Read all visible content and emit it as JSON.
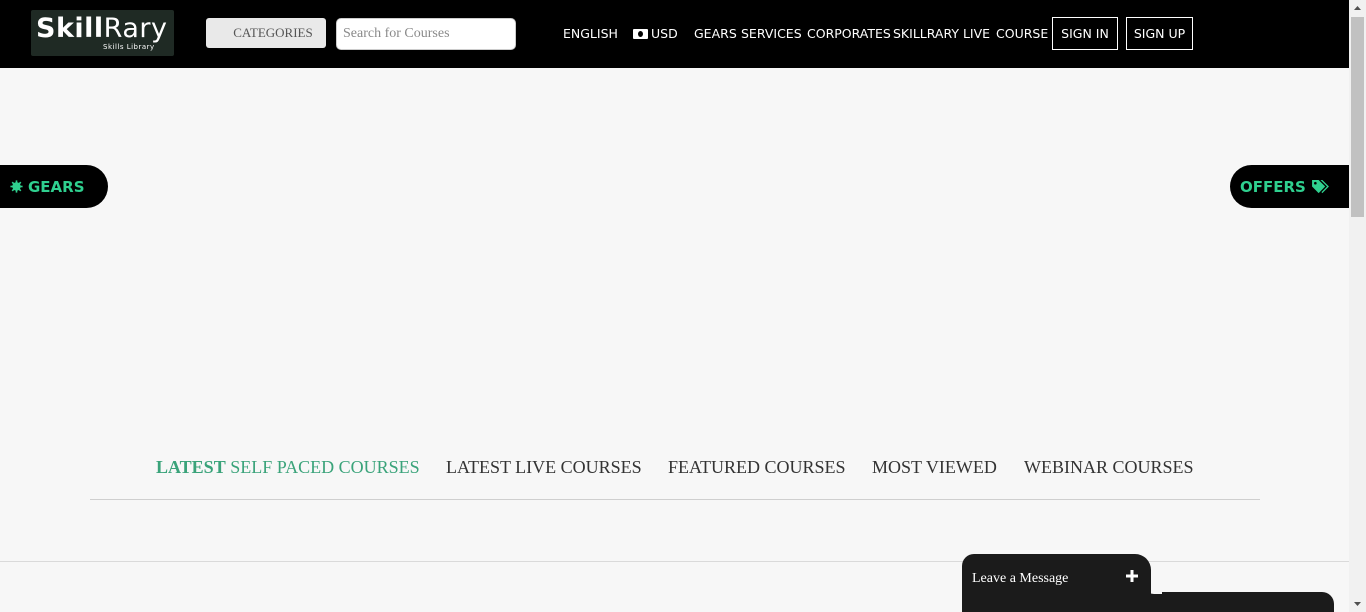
{
  "header": {
    "logo_main_a": "Skill",
    "logo_main_b": "Rary",
    "logo_sub": "Skills Library",
    "categories_label": "CATEGORIES",
    "search_placeholder": "Search for Courses",
    "nav": {
      "language": "ENGLISH",
      "currency": "USD",
      "gears": "GEARS",
      "services": "SERVICES",
      "corporates": "CORPORATES",
      "skillrary_live": "SKILLRARY LIVE",
      "course": "COURSE"
    },
    "sign_in": "SIGN IN",
    "sign_up": "SIGN UP"
  },
  "side_tabs": {
    "gears": "GEARS",
    "offers": "OFFERS"
  },
  "course_tabs": {
    "latest_self_paced_a": "LATEST",
    "latest_self_paced_b": " SELF PACED COURSES",
    "latest_live": "LATEST LIVE COURSES",
    "featured": "FEATURED COURSES",
    "most_viewed": "MOST VIEWED",
    "webinar": "WEBINAR COURSES"
  },
  "chat": {
    "label": "Leave a Message"
  },
  "colors": {
    "accent": "#2fd08f",
    "active_tab": "#3aa37a",
    "header_bg": "#000000",
    "page_bg": "#f7f7f7"
  },
  "icons": [
    "money-icon",
    "gear-icon",
    "tag-icon",
    "plus-icon",
    "scroll-up-icon",
    "scroll-down-icon"
  ]
}
